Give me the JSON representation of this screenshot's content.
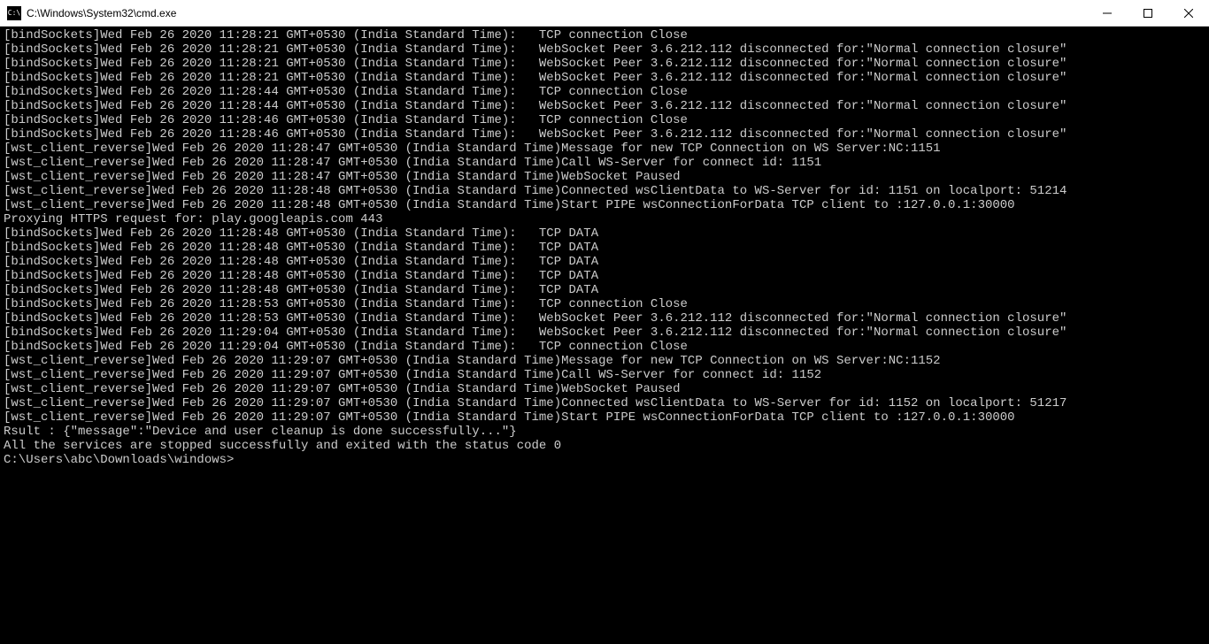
{
  "titlebar": {
    "icon_text": "C:\\",
    "title": "C:\\Windows\\System32\\cmd.exe"
  },
  "console": {
    "lines": [
      "[bindSockets]Wed Feb 26 2020 11:28:21 GMT+0530 (India Standard Time):   TCP connection Close",
      "[bindSockets]Wed Feb 26 2020 11:28:21 GMT+0530 (India Standard Time):   WebSocket Peer 3.6.212.112 disconnected for:\"Normal connection closure\"",
      "[bindSockets]Wed Feb 26 2020 11:28:21 GMT+0530 (India Standard Time):   WebSocket Peer 3.6.212.112 disconnected for:\"Normal connection closure\"",
      "[bindSockets]Wed Feb 26 2020 11:28:21 GMT+0530 (India Standard Time):   WebSocket Peer 3.6.212.112 disconnected for:\"Normal connection closure\"",
      "[bindSockets]Wed Feb 26 2020 11:28:44 GMT+0530 (India Standard Time):   TCP connection Close",
      "[bindSockets]Wed Feb 26 2020 11:28:44 GMT+0530 (India Standard Time):   WebSocket Peer 3.6.212.112 disconnected for:\"Normal connection closure\"",
      "[bindSockets]Wed Feb 26 2020 11:28:46 GMT+0530 (India Standard Time):   TCP connection Close",
      "[bindSockets]Wed Feb 26 2020 11:28:46 GMT+0530 (India Standard Time):   WebSocket Peer 3.6.212.112 disconnected for:\"Normal connection closure\"",
      "[wst_client_reverse]Wed Feb 26 2020 11:28:47 GMT+0530 (India Standard Time)Message for new TCP Connection on WS Server:NC:1151",
      "[wst_client_reverse]Wed Feb 26 2020 11:28:47 GMT+0530 (India Standard Time)Call WS-Server for connect id: 1151",
      "[wst_client_reverse]Wed Feb 26 2020 11:28:47 GMT+0530 (India Standard Time)WebSocket Paused",
      "[wst_client_reverse]Wed Feb 26 2020 11:28:48 GMT+0530 (India Standard Time)Connected wsClientData to WS-Server for id: 1151 on localport: 51214",
      "[wst_client_reverse]Wed Feb 26 2020 11:28:48 GMT+0530 (India Standard Time)Start PIPE wsConnectionForData TCP client to :127.0.0.1:30000",
      "Proxying HTTPS request for: play.googleapis.com 443",
      "[bindSockets]Wed Feb 26 2020 11:28:48 GMT+0530 (India Standard Time):   TCP DATA",
      "[bindSockets]Wed Feb 26 2020 11:28:48 GMT+0530 (India Standard Time):   TCP DATA",
      "[bindSockets]Wed Feb 26 2020 11:28:48 GMT+0530 (India Standard Time):   TCP DATA",
      "[bindSockets]Wed Feb 26 2020 11:28:48 GMT+0530 (India Standard Time):   TCP DATA",
      "[bindSockets]Wed Feb 26 2020 11:28:48 GMT+0530 (India Standard Time):   TCP DATA",
      "[bindSockets]Wed Feb 26 2020 11:28:53 GMT+0530 (India Standard Time):   TCP connection Close",
      "[bindSockets]Wed Feb 26 2020 11:28:53 GMT+0530 (India Standard Time):   WebSocket Peer 3.6.212.112 disconnected for:\"Normal connection closure\"",
      "[bindSockets]Wed Feb 26 2020 11:29:04 GMT+0530 (India Standard Time):   WebSocket Peer 3.6.212.112 disconnected for:\"Normal connection closure\"",
      "[bindSockets]Wed Feb 26 2020 11:29:04 GMT+0530 (India Standard Time):   TCP connection Close",
      "[wst_client_reverse]Wed Feb 26 2020 11:29:07 GMT+0530 (India Standard Time)Message for new TCP Connection on WS Server:NC:1152",
      "[wst_client_reverse]Wed Feb 26 2020 11:29:07 GMT+0530 (India Standard Time)Call WS-Server for connect id: 1152",
      "[wst_client_reverse]Wed Feb 26 2020 11:29:07 GMT+0530 (India Standard Time)WebSocket Paused",
      "[wst_client_reverse]Wed Feb 26 2020 11:29:07 GMT+0530 (India Standard Time)Connected wsClientData to WS-Server for id: 1152 on localport: 51217",
      "[wst_client_reverse]Wed Feb 26 2020 11:29:07 GMT+0530 (India Standard Time)Start PIPE wsConnectionForData TCP client to :127.0.0.1:30000",
      "Rsult : {\"message\":\"Device and user cleanup is done successfully...\"}",
      "All the services are stopped successfully and exited with the status code 0",
      "",
      "C:\\Users\\abc\\Downloads\\windows>"
    ]
  }
}
